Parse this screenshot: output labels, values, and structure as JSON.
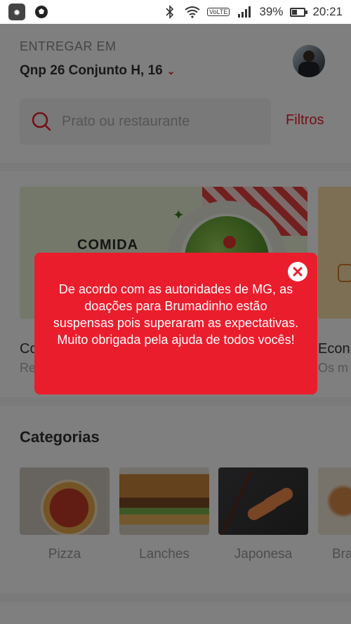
{
  "status_bar": {
    "battery": "39%",
    "time": "20:21",
    "lte_label": "VoLTE",
    "battery_level": 0.39
  },
  "header": {
    "deliver_label": "ENTREGAR EM",
    "address": "Qnp 26 Conjunto H, 16"
  },
  "search": {
    "placeholder": "Prato ou restaurante",
    "filters_label": "Filtros"
  },
  "banners": [
    {
      "image_label": "COMIDA",
      "title": "Co",
      "subtitle": "Re"
    },
    {
      "title": "Econ",
      "subtitle": "Os m"
    }
  ],
  "categories": {
    "heading": "Categorias",
    "items": [
      {
        "label": "Pizza"
      },
      {
        "label": "Lanches"
      },
      {
        "label": "Japonesa"
      },
      {
        "label": "Bra"
      }
    ]
  },
  "modal": {
    "message": "De acordo com as autoridades de MG, as doações para Brumadinho estão suspensas pois superaram as expectativas. Muito obrigada pela ajuda de todos vocês!"
  },
  "colors": {
    "brand_red": "#ea1d2c",
    "overlay": "rgba(0,0,0,0.5)"
  }
}
